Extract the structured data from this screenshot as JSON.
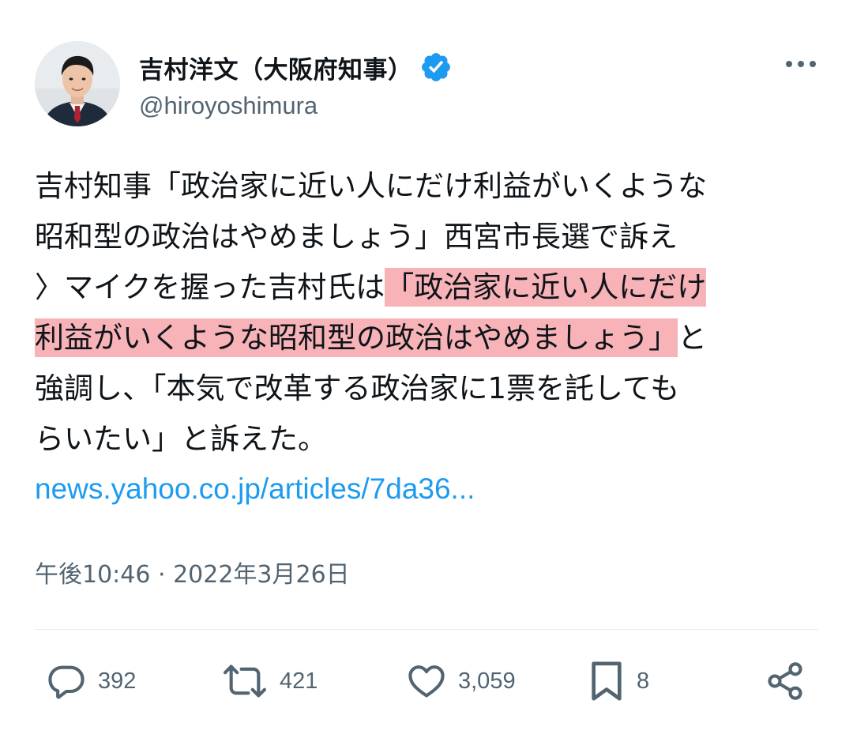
{
  "author": {
    "display_name": "吉村洋文（大阪府知事）",
    "handle": "@hiroyoshimura",
    "verified": true
  },
  "tweet": {
    "lines": [
      {
        "before": "吉村知事「政治家に近い人にだけ利益がいくような",
        "highlight": "",
        "after": ""
      },
      {
        "before": "昭和型の政治はやめましょう」西宮市長選で訴え",
        "highlight": "",
        "after": ""
      },
      {
        "before": "〉マイクを握った吉村氏は",
        "highlight": "「政治家に近い人にだけ",
        "after": ""
      },
      {
        "before": "",
        "highlight": "利益がいくような昭和型の政治はやめましょう」",
        "after": "と"
      },
      {
        "before": "強調し、「本気で改革する政治家に1票を託しても",
        "highlight": "",
        "after": ""
      },
      {
        "before": "らいたい」と訴えた。",
        "highlight": "",
        "after": ""
      }
    ],
    "link": "news.yahoo.co.jp/articles/7da36...",
    "timestamp": "午後10:46 · 2022年3月26日"
  },
  "actions": {
    "reply_count": "392",
    "retweet_count": "421",
    "like_count": "3,059",
    "bookmark_count": "8"
  },
  "colors": {
    "text": "#0f1419",
    "secondary": "#536471",
    "link": "#1d9bf0",
    "highlight": "#f7b3b8",
    "verified": "#1d9bf0"
  },
  "icons": {
    "more": "more-dots-icon",
    "verified": "verified-badge-icon",
    "reply": "reply-icon",
    "retweet": "retweet-icon",
    "like": "heart-icon",
    "bookmark": "bookmark-icon",
    "share": "share-icon"
  }
}
